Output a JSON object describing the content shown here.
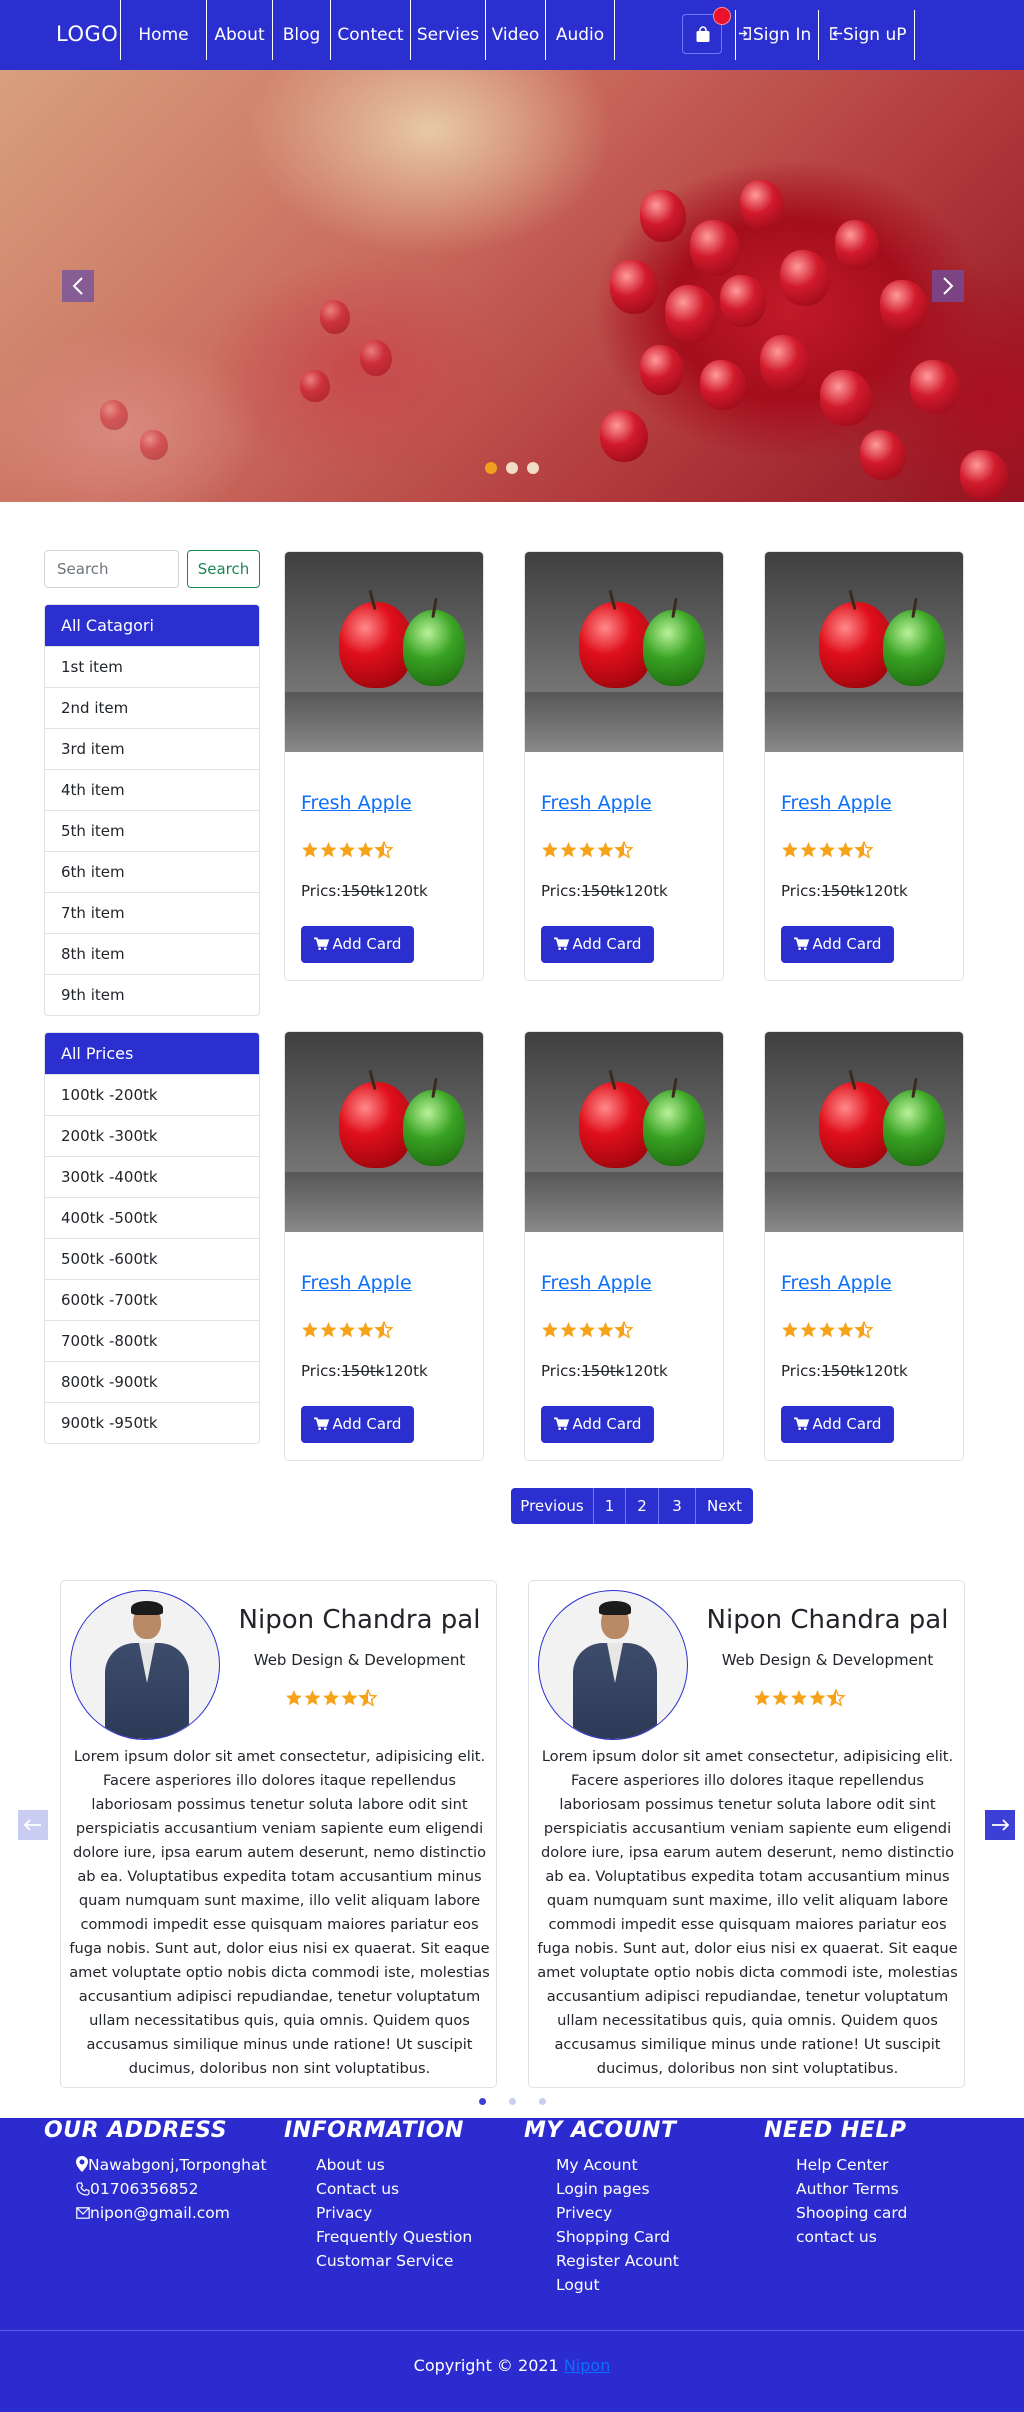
{
  "navbar": {
    "logo": "LOGO",
    "links": [
      "Home",
      "About",
      "Blog",
      "Contect",
      "Servies",
      "Video",
      "Audio"
    ],
    "cart_icon": "shopping-bag-icon",
    "sign_in": "Sign In",
    "sign_up": "Sign uP",
    "colors": {
      "bar": "#2b2fcf",
      "badge": "#e8122d"
    }
  },
  "hero": {
    "image": "pomegranate",
    "prev_icon": "chevron-left-icon",
    "next_icon": "chevron-right-icon",
    "active_slide": 1,
    "slide_count": 3
  },
  "sidebar": {
    "search_placeholder": "Search",
    "search_button": "Search",
    "categories_title": "All Catagori",
    "categories": [
      "1st item",
      "2nd item",
      "3rd item",
      "4th item",
      "5th item",
      "6th item",
      "7th item",
      "8th item",
      "9th item"
    ],
    "prices_title": "All Prices",
    "prices": [
      "100tk -200tk",
      "200tk -300tk",
      "300tk -400tk",
      "400tk -500tk",
      "500tk -600tk",
      "600tk -700tk",
      "700tk -800tk",
      "800tk -900tk",
      "900tk -950tk"
    ]
  },
  "products": [
    {
      "title": "Fresh Apple",
      "rating": 4.5,
      "price_label": "Prics:",
      "old_price": "150tk",
      "new_price": "120tk",
      "button": "Add Card"
    },
    {
      "title": "Fresh Apple",
      "rating": 4.5,
      "price_label": "Prics:",
      "old_price": "150tk",
      "new_price": "120tk",
      "button": "Add Card"
    },
    {
      "title": "Fresh Apple",
      "rating": 4.5,
      "price_label": "Prics:",
      "old_price": "150tk",
      "new_price": "120tk",
      "button": "Add Card"
    },
    {
      "title": "Fresh Apple",
      "rating": 4.5,
      "price_label": "Prics:",
      "old_price": "150tk",
      "new_price": "120tk",
      "button": "Add Card"
    },
    {
      "title": "Fresh Apple",
      "rating": 4.5,
      "price_label": "Prics:",
      "old_price": "150tk",
      "new_price": "120tk",
      "button": "Add Card"
    },
    {
      "title": "Fresh Apple",
      "rating": 4.5,
      "price_label": "Prics:",
      "old_price": "150tk",
      "new_price": "120tk",
      "button": "Add Card"
    }
  ],
  "pagination": {
    "previous": "Previous",
    "pages": [
      "1",
      "2",
      "3"
    ],
    "next": "Next"
  },
  "testimonials": [
    {
      "name": "Nipon Chandra pal",
      "role": "Web Design & Development",
      "rating": 4.5,
      "text": "Lorem ipsum dolor sit amet consectetur, adipisicing elit. Facere asperiores illo dolores itaque repellendus laboriosam possimus tenetur soluta labore odit sint perspiciatis accusantium veniam sapiente eum eligendi dolore iure, ipsa earum autem deserunt, nemo distinctio ab ea. Voluptatibus expedita totam accusantium minus quam numquam sunt maxime, illo velit aliquam labore commodi impedit esse quisquam maiores pariatur eos fuga nobis. Sunt aut, dolor eius nisi ex quaerat. Sit eaque amet voluptate optio nobis dicta commodi iste, molestias accusantium adipisci repudiandae, tenetur voluptatum ullam necessitatibus quis, quia omnis. Quidem quos accusamus similique minus unde ratione! Ut suscipit ducimus, doloribus non sint voluptatibus."
    },
    {
      "name": "Nipon Chandra pal",
      "role": "Web Design & Development",
      "rating": 4.5,
      "text": "Lorem ipsum dolor sit amet consectetur, adipisicing elit. Facere asperiores illo dolores itaque repellendus laboriosam possimus tenetur soluta labore odit sint perspiciatis accusantium veniam sapiente eum eligendi dolore iure, ipsa earum autem deserunt, nemo distinctio ab ea. Voluptatibus expedita totam accusantium minus quam numquam sunt maxime, illo velit aliquam labore commodi impedit esse quisquam maiores pariatur eos fuga nobis. Sunt aut, dolor eius nisi ex quaerat. Sit eaque amet voluptate optio nobis dicta commodi iste, molestias accusantium adipisci repudiandae, tenetur voluptatum ullam necessitatibus quis, quia omnis. Quidem quos accusamus similique minus unde ratione! Ut suscipit ducimus, doloribus non sint voluptatibus."
    }
  ],
  "testimonial_carousel": {
    "prev_icon": "arrow-left-icon",
    "next_icon": "arrow-right-icon",
    "active_slide": 1,
    "slide_count": 3
  },
  "footer": {
    "address": {
      "title": "OUR ADDRESS",
      "location": "Nawabgonj,Torponghat",
      "phone": "01706356852",
      "email": "nipon@gmail.com"
    },
    "information": {
      "title": "INFORMATION",
      "links": [
        "About us",
        "Contact us",
        "Privacy",
        "Frequently Question",
        "Customar Service"
      ]
    },
    "account": {
      "title": "MY ACOUNT",
      "links": [
        "My Acount",
        "Login pages",
        "Privecy",
        "Shopping Card",
        "Register Acount",
        "Logut"
      ]
    },
    "help": {
      "title": "NEED HELP",
      "links": [
        "Help Center",
        "Author Terms",
        "Shooping card",
        "contact us"
      ]
    },
    "copyright_prefix": "Copyright © 2021",
    "copyright_link": "Nipon",
    "colors": {
      "background": "#2b2bd0"
    }
  }
}
